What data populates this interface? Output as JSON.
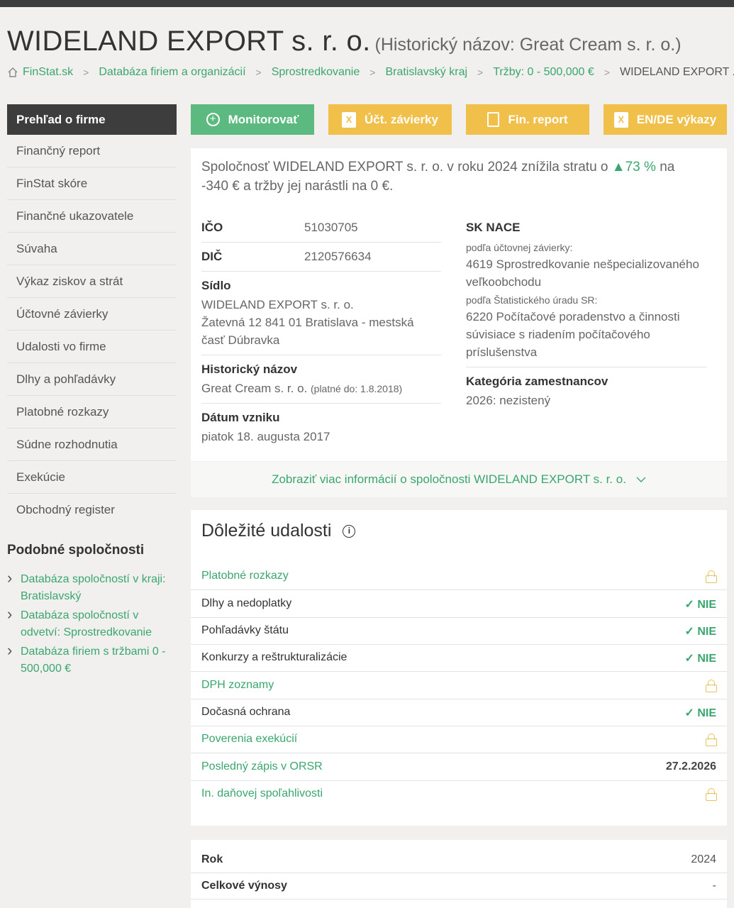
{
  "title": {
    "name": "WIDELAND EXPORT s. r. o.",
    "historic": "(Historický názov: Great Cream s. r. o.)"
  },
  "breadcrumb": [
    "FinStat.sk",
    "Databáza firiem a organizácií",
    "Sprostredkovanie",
    "Bratislavský kraj",
    "Tržby: 0 - 500,000 €",
    "WIDELAND EXPORT ..."
  ],
  "sidebar": {
    "active": "Prehľad o firme",
    "items": [
      "Finančný report",
      "FinStat skóre",
      "Finančné ukazovatele",
      "Súvaha",
      "Výkaz ziskov a strát",
      "Účtovné závierky",
      "Udalosti vo firme",
      "Dlhy a pohľadávky",
      "Platobné rozkazy",
      "Súdne rozhodnutia",
      "Exekúcie",
      "Obchodný register"
    ],
    "similar_title": "Podobné spoločnosti",
    "similar": [
      "Databáza spoločností v kraji: Bratislavský",
      "Databáza spoločností v odvetví: Sprostredkovanie",
      "Databáza firiem s tržbami 0 - 500,000 €"
    ]
  },
  "buttons": {
    "monitor": "Monitorovať",
    "accounts": "Účt. závierky",
    "fin": "Fin. report",
    "ende": "EN/DE výkazy"
  },
  "summary": {
    "before": "Spoločnosť WIDELAND EXPORT s. r. o. v roku 2024 znížila stratu o",
    "pct": "73 %",
    "after": "na -340 € a tržby jej narástli na 0 €."
  },
  "info": {
    "ico_l": "IČO",
    "ico": "51030705",
    "dic_l": "DIČ",
    "dic": "2120576634",
    "sidlo_l": "Sídlo",
    "sidlo1": "WIDELAND EXPORT s. r. o.",
    "sidlo2": "Žatevná 12 841 01 Bratislava - mestská",
    "sidlo3": "časť Dúbravka",
    "hist_l": "Historický názov",
    "hist": "Great Cream s. r. o.",
    "hist_note": "(platné do: 1.8.2018)",
    "vznik_l": "Dátum vzniku",
    "vznik": "piatok 18. augusta 2017",
    "nace_l": "SK NACE",
    "nace_sub1": "podľa účtovnej závierky:",
    "nace1a": "4619 Sprostredkovanie nešpecializovaného",
    "nace1b": "veľkoobchodu",
    "nace_sub2": "podľa Štatistického úradu SR:",
    "nace2a": "6220 Počítačové poradenstvo a činnosti",
    "nace2b": "súvisiace s riadením počítačového",
    "nace2c": "príslušenstva",
    "kat_l": "Kategória zamestnancov",
    "kat": "2026: nezistený"
  },
  "more": "Zobraziť viac informácií o spoločnosti WIDELAND EXPORT s. r. o.",
  "events": {
    "title": "Dôležité udalosti",
    "rows": [
      {
        "name": "Platobné rozkazy",
        "value": ""
      },
      {
        "name": "Dlhy a nedoplatky",
        "value": "NIE"
      },
      {
        "name": "Pohľadávky štátu",
        "value": "NIE"
      },
      {
        "name": "Konkurzy a reštrukturalizácie",
        "value": "NIE"
      },
      {
        "name": "DPH zoznamy",
        "value": ""
      },
      {
        "name": "Dočasná ochrana",
        "value": "NIE"
      },
      {
        "name": "Poverenia exekúcií",
        "value": ""
      },
      {
        "name": "Posledný zápis v ORSR",
        "value": "27.2.2026"
      },
      {
        "name": "In. daňovej spoľahlivosti",
        "value": ""
      }
    ]
  },
  "fin": [
    {
      "k": "Rok",
      "v": "2024"
    },
    {
      "k": "Celkové výnosy",
      "v": "-"
    }
  ]
}
